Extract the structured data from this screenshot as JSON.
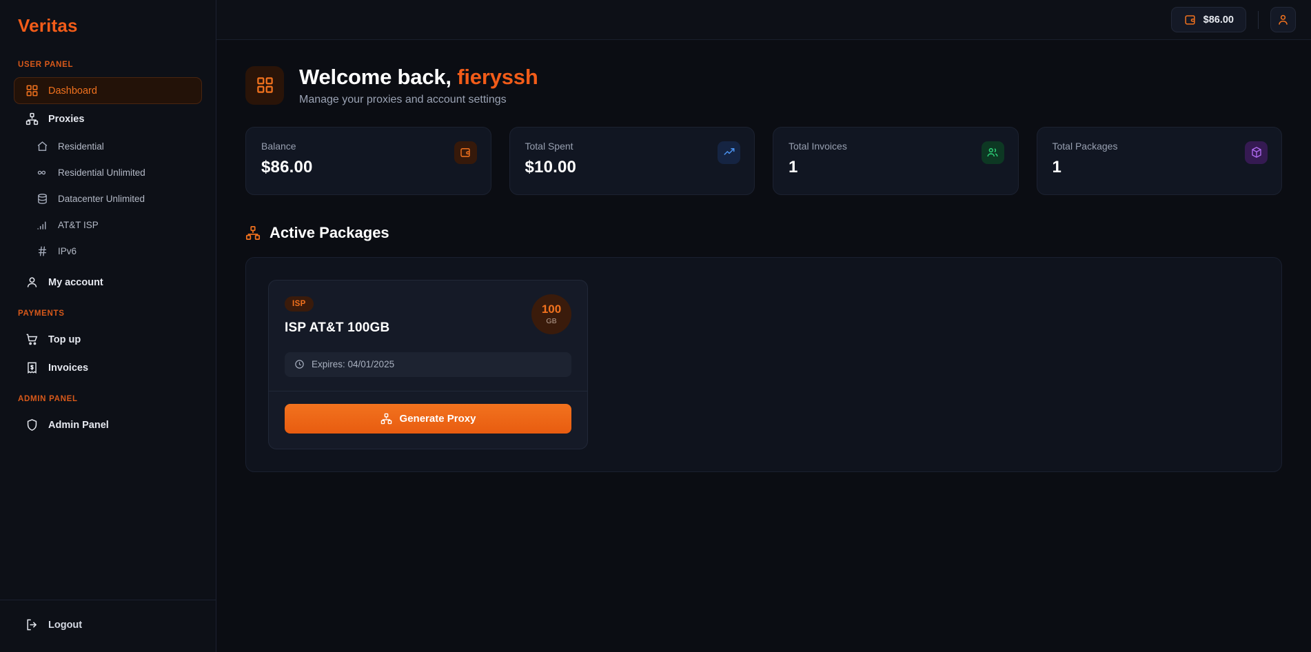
{
  "brand": {
    "name": "Veritas"
  },
  "sidebar": {
    "sections": [
      {
        "label": "USER PANEL"
      },
      {
        "label": "PAYMENTS"
      },
      {
        "label": "ADMIN PANEL"
      }
    ],
    "items": [
      {
        "label": "Dashboard",
        "icon": "grid-icon",
        "active": true
      },
      {
        "label": "Proxies",
        "icon": "network-icon",
        "active": false
      },
      {
        "label": "Residential",
        "icon": "home-icon",
        "active": false
      },
      {
        "label": "Residential Unlimited",
        "icon": "infinity-icon",
        "active": false
      },
      {
        "label": "Datacenter Unlimited",
        "icon": "database-icon",
        "active": false
      },
      {
        "label": "AT&T ISP",
        "icon": "signal-bars-icon",
        "active": false
      },
      {
        "label": "IPv6",
        "icon": "hash-icon",
        "active": false
      },
      {
        "label": "My account",
        "icon": "user-icon",
        "active": false
      },
      {
        "label": "Top up",
        "icon": "cart-icon",
        "active": false
      },
      {
        "label": "Invoices",
        "icon": "receipt-dollar-icon",
        "active": false
      },
      {
        "label": "Admin Panel",
        "icon": "shield-icon",
        "active": false
      },
      {
        "label": "Logout",
        "icon": "logout-icon",
        "active": false
      }
    ]
  },
  "topbar": {
    "balance": "$86.00",
    "balance_icon": "wallet-icon",
    "avatar_icon": "user-icon"
  },
  "welcome": {
    "greeting": "Welcome back,",
    "username": "fieryssh",
    "subtitle": "Manage your proxies and account settings",
    "icon": "grid-icon"
  },
  "stats": [
    {
      "label": "Balance",
      "value": "$86.00",
      "icon": "wallet-icon",
      "icon_color": "#F2721E",
      "badge_bg": "#36190A"
    },
    {
      "label": "Total Spent",
      "value": "$10.00",
      "icon": "trending-up-icon",
      "icon_color": "#4B93F0",
      "badge_bg": "#152442"
    },
    {
      "label": "Total Invoices",
      "value": "1",
      "icon": "users-icon",
      "icon_color": "#2ED47A",
      "badge_bg": "#0D3823"
    },
    {
      "label": "Total Packages",
      "value": "1",
      "icon": "package-icon",
      "icon_color": "#B06BF0",
      "badge_bg": "#351A52"
    }
  ],
  "active_packages": {
    "title": "Active Packages",
    "icon": "network-icon",
    "packages": [
      {
        "tag": "ISP",
        "name": "ISP AT&T 100GB",
        "quota_amount": "100",
        "quota_unit": "GB",
        "expiry": "Expires: 04/01/2025",
        "expiry_icon": "clock-icon",
        "action_label": "Generate Proxy",
        "action_icon": "network-icon"
      }
    ]
  },
  "theme": {
    "accent": "#F2721E",
    "brand_orange": "#F25C19",
    "bg": "#0B0D13",
    "sidebar_bg": "#0D1017",
    "card_bg": "#111622"
  }
}
